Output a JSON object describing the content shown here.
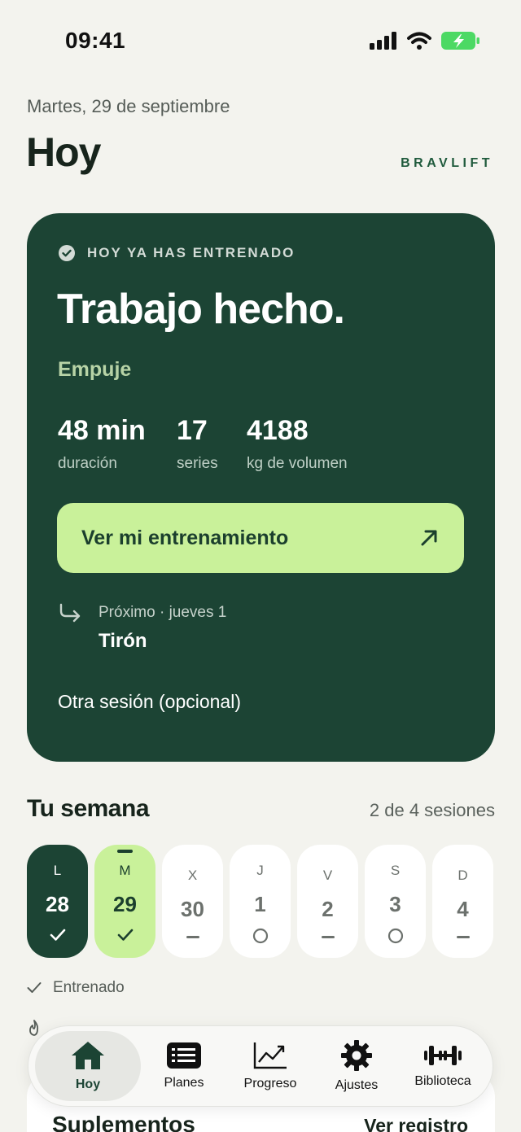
{
  "status": {
    "time": "09:41"
  },
  "header": {
    "date": "Martes, 29 de septiembre",
    "title": "Hoy",
    "brand": "BRAVLIFT"
  },
  "hero": {
    "badge": "HOY YA HAS ENTRENADO",
    "title": "Trabajo hecho.",
    "subtitle": "Empuje",
    "stats": [
      {
        "value": "48 min",
        "label": "duración"
      },
      {
        "value": "17",
        "label": "series"
      },
      {
        "value": "4188",
        "label": "kg de volumen"
      }
    ],
    "cta_label": "Ver mi entrenamiento",
    "next_meta": "Próximo · jueves 1",
    "next_name": "Tirón",
    "extra_session": "Otra sesión (opcional)"
  },
  "week": {
    "title": "Tu semana",
    "count": "2 de 4 sesiones",
    "days": [
      {
        "letter": "L",
        "num": "28",
        "state": "done"
      },
      {
        "letter": "M",
        "num": "29",
        "state": "today"
      },
      {
        "letter": "X",
        "num": "30",
        "state": "rest"
      },
      {
        "letter": "J",
        "num": "1",
        "state": "planned"
      },
      {
        "letter": "V",
        "num": "2",
        "state": "rest"
      },
      {
        "letter": "S",
        "num": "3",
        "state": "planned"
      },
      {
        "letter": "D",
        "num": "4",
        "state": "rest"
      }
    ],
    "legend": "Entrenado"
  },
  "supplements": {
    "title": "Suplementos",
    "link": "Ver registro"
  },
  "tabs": [
    {
      "label": "Hoy",
      "icon": "home-icon"
    },
    {
      "label": "Planes",
      "icon": "list-icon"
    },
    {
      "label": "Progreso",
      "icon": "chart-icon"
    },
    {
      "label": "Ajustes",
      "icon": "gear-icon"
    },
    {
      "label": "Biblioteca",
      "icon": "dumbbell-icon"
    }
  ],
  "colors": {
    "primary": "#1c4434",
    "accent": "#c9f19a",
    "background": "#f3f3ee"
  }
}
